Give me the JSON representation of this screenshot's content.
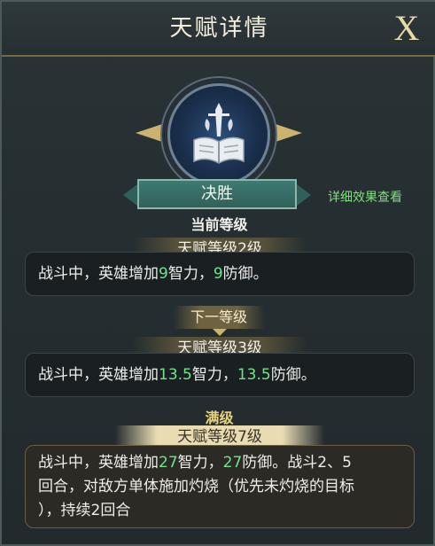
{
  "window": {
    "title": "天赋详情",
    "close_label": "X"
  },
  "talent": {
    "name": "决胜",
    "detail_link": "详细效果查看",
    "icon": "book-sword-icon"
  },
  "current": {
    "section_label": "当前等级",
    "level_label": "天赋等级2级",
    "desc_prefix": "战斗中，英雄增加",
    "int_value": "9",
    "int_suffix": "智力，",
    "def_value": "9",
    "def_suffix": "防御。"
  },
  "next": {
    "section_label": "下一等级",
    "level_label": "天赋等级3级",
    "desc_prefix": "战斗中，英雄增加",
    "int_value": "13.5",
    "int_suffix": "智力，",
    "def_value": "13.5",
    "def_suffix": "防御。"
  },
  "max": {
    "section_label": "满级",
    "level_label": "天赋等级7级",
    "desc_prefix": "战斗中，英雄增加",
    "int_value": "27",
    "int_suffix": "智力，",
    "def_value": "27",
    "def_suffix": "防御。战斗2、5",
    "line2": "回合，对敌方单体施加灼烧（优先未灼烧的目标",
    "line3": "），持续2回合"
  },
  "colors": {
    "accent_green": "#6fe58a",
    "link_green": "#7be37a",
    "gold": "#c9b36e",
    "ribbon_teal": "#3f7a72"
  }
}
